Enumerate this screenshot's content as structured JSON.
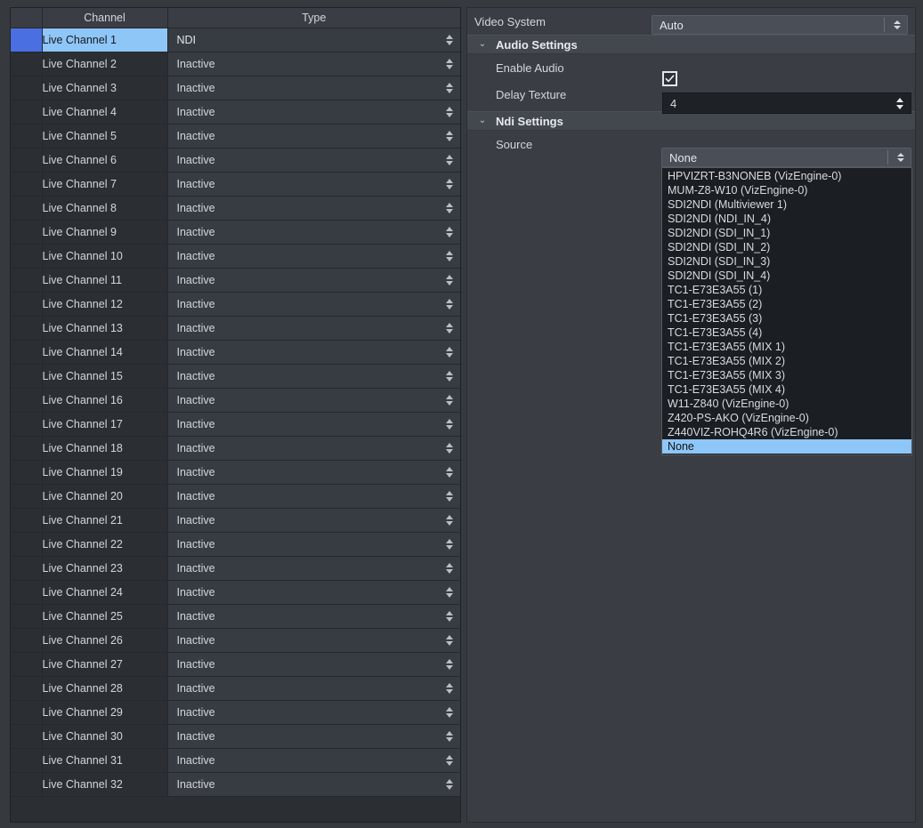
{
  "table": {
    "columns": [
      "",
      "Channel",
      "Type"
    ],
    "column_names": {
      "indicator": "",
      "channel": "Channel",
      "type": "Type"
    },
    "selected_row_index": 0,
    "rows": [
      {
        "channel": "Live Channel 1",
        "type": "NDI"
      },
      {
        "channel": "Live Channel 2",
        "type": "Inactive"
      },
      {
        "channel": "Live Channel 3",
        "type": "Inactive"
      },
      {
        "channel": "Live Channel 4",
        "type": "Inactive"
      },
      {
        "channel": "Live Channel 5",
        "type": "Inactive"
      },
      {
        "channel": "Live Channel 6",
        "type": "Inactive"
      },
      {
        "channel": "Live Channel 7",
        "type": "Inactive"
      },
      {
        "channel": "Live Channel 8",
        "type": "Inactive"
      },
      {
        "channel": "Live Channel 9",
        "type": "Inactive"
      },
      {
        "channel": "Live Channel 10",
        "type": "Inactive"
      },
      {
        "channel": "Live Channel 11",
        "type": "Inactive"
      },
      {
        "channel": "Live Channel 12",
        "type": "Inactive"
      },
      {
        "channel": "Live Channel 13",
        "type": "Inactive"
      },
      {
        "channel": "Live Channel 14",
        "type": "Inactive"
      },
      {
        "channel": "Live Channel 15",
        "type": "Inactive"
      },
      {
        "channel": "Live Channel 16",
        "type": "Inactive"
      },
      {
        "channel": "Live Channel 17",
        "type": "Inactive"
      },
      {
        "channel": "Live Channel 18",
        "type": "Inactive"
      },
      {
        "channel": "Live Channel 19",
        "type": "Inactive"
      },
      {
        "channel": "Live Channel 20",
        "type": "Inactive"
      },
      {
        "channel": "Live Channel 21",
        "type": "Inactive"
      },
      {
        "channel": "Live Channel 22",
        "type": "Inactive"
      },
      {
        "channel": "Live Channel 23",
        "type": "Inactive"
      },
      {
        "channel": "Live Channel 24",
        "type": "Inactive"
      },
      {
        "channel": "Live Channel 25",
        "type": "Inactive"
      },
      {
        "channel": "Live Channel 26",
        "type": "Inactive"
      },
      {
        "channel": "Live Channel 27",
        "type": "Inactive"
      },
      {
        "channel": "Live Channel 28",
        "type": "Inactive"
      },
      {
        "channel": "Live Channel 29",
        "type": "Inactive"
      },
      {
        "channel": "Live Channel 30",
        "type": "Inactive"
      },
      {
        "channel": "Live Channel 31",
        "type": "Inactive"
      },
      {
        "channel": "Live Channel 32",
        "type": "Inactive"
      }
    ]
  },
  "settings": {
    "video_system": {
      "label": "Video System",
      "value": "Auto"
    },
    "audio_section": {
      "title": "Audio Settings",
      "expanded": true,
      "chevron": "⌄",
      "enable_audio": {
        "label": "Enable Audio",
        "checked": true
      },
      "delay_texture": {
        "label": "Delay Texture",
        "value": "4"
      }
    },
    "ndi_section": {
      "title": "Ndi Settings",
      "expanded": true,
      "chevron": "⌄",
      "source": {
        "label": "Source",
        "value": "None",
        "dropdown_open": true,
        "selected_option": "None",
        "options": [
          "HPVIZRT-B3NONEB (VizEngine-0)",
          "MUM-Z8-W10 (VizEngine-0)",
          "SDI2NDI (Multiviewer 1)",
          "SDI2NDI (NDI_IN_4)",
          "SDI2NDI (SDI_IN_1)",
          "SDI2NDI (SDI_IN_2)",
          "SDI2NDI (SDI_IN_3)",
          "SDI2NDI (SDI_IN_4)",
          "TC1-E73E3A55 (1)",
          "TC1-E73E3A55 (2)",
          "TC1-E73E3A55 (3)",
          "TC1-E73E3A55 (4)",
          "TC1-E73E3A55 (MIX 1)",
          "TC1-E73E3A55 (MIX 2)",
          "TC1-E73E3A55 (MIX 3)",
          "TC1-E73E3A55 (MIX 4)",
          "W11-Z840 (VizEngine-0)",
          "Z420-PS-AKO (VizEngine-0)",
          "Z440VIZ-ROHQ4R6 (VizEngine-0)",
          "None"
        ]
      }
    }
  },
  "colors": {
    "window_bg": "#36393d",
    "table_bg": "#2b2e33",
    "header_bg": "#3a3d43",
    "type_cell_bg": "#373b42",
    "panel_bg": "#3a3e44",
    "section_bg": "#43474e",
    "selection_blue": "#8ec6f7",
    "indicator_blue": "#4a6fe0",
    "dropdown_bg": "#1b1e22",
    "text": "#d3d7db"
  }
}
